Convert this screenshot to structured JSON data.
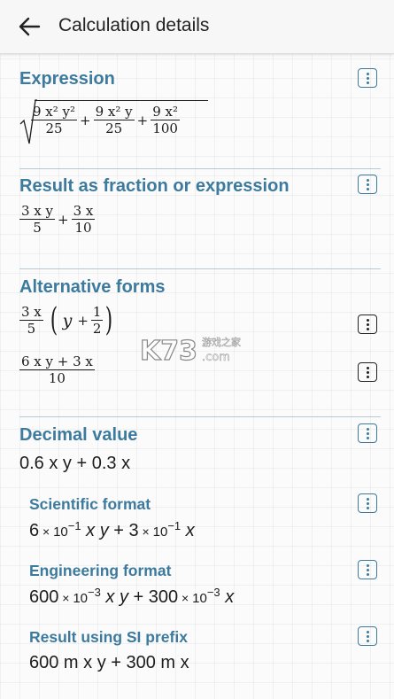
{
  "header": {
    "title": "Calculation details"
  },
  "sections": {
    "expression": {
      "title": "Expression"
    },
    "result": {
      "title": "Result as fraction or expression"
    },
    "alternative": {
      "title": "Alternative forms"
    },
    "decimal": {
      "title": "Decimal value",
      "value": "0.6 x y + 0.3 x",
      "scientific": {
        "title": "Scientific format",
        "c1": "6",
        "e1": "−1",
        "c2": "3",
        "e2": "−1"
      },
      "engineering": {
        "title": "Engineering format",
        "c1": "600",
        "e1": "−3",
        "c2": "300",
        "e2": "−3"
      },
      "si": {
        "title": "Result using SI prefix",
        "value": "600 m x y + 300 m x"
      }
    }
  },
  "math": {
    "expr_num1": "9 x² y²",
    "expr_den1": "25",
    "expr_num2": "9 x² y",
    "expr_den2": "25",
    "expr_num3": "9 x²",
    "expr_den3": "100",
    "res_num1": "3 x y",
    "res_den1": "5",
    "res_num2": "3 x",
    "res_den2": "10",
    "alt1_num": "3 x",
    "alt1_den": "5",
    "alt1_y": "y",
    "alt1_half_num": "1",
    "alt1_half_den": "2",
    "alt2_num": "6 x y + 3 x",
    "alt2_den": "10"
  },
  "watermark": {
    "text_k": "K73",
    "text_cn": "游戏之家",
    "text_url": ".com"
  }
}
